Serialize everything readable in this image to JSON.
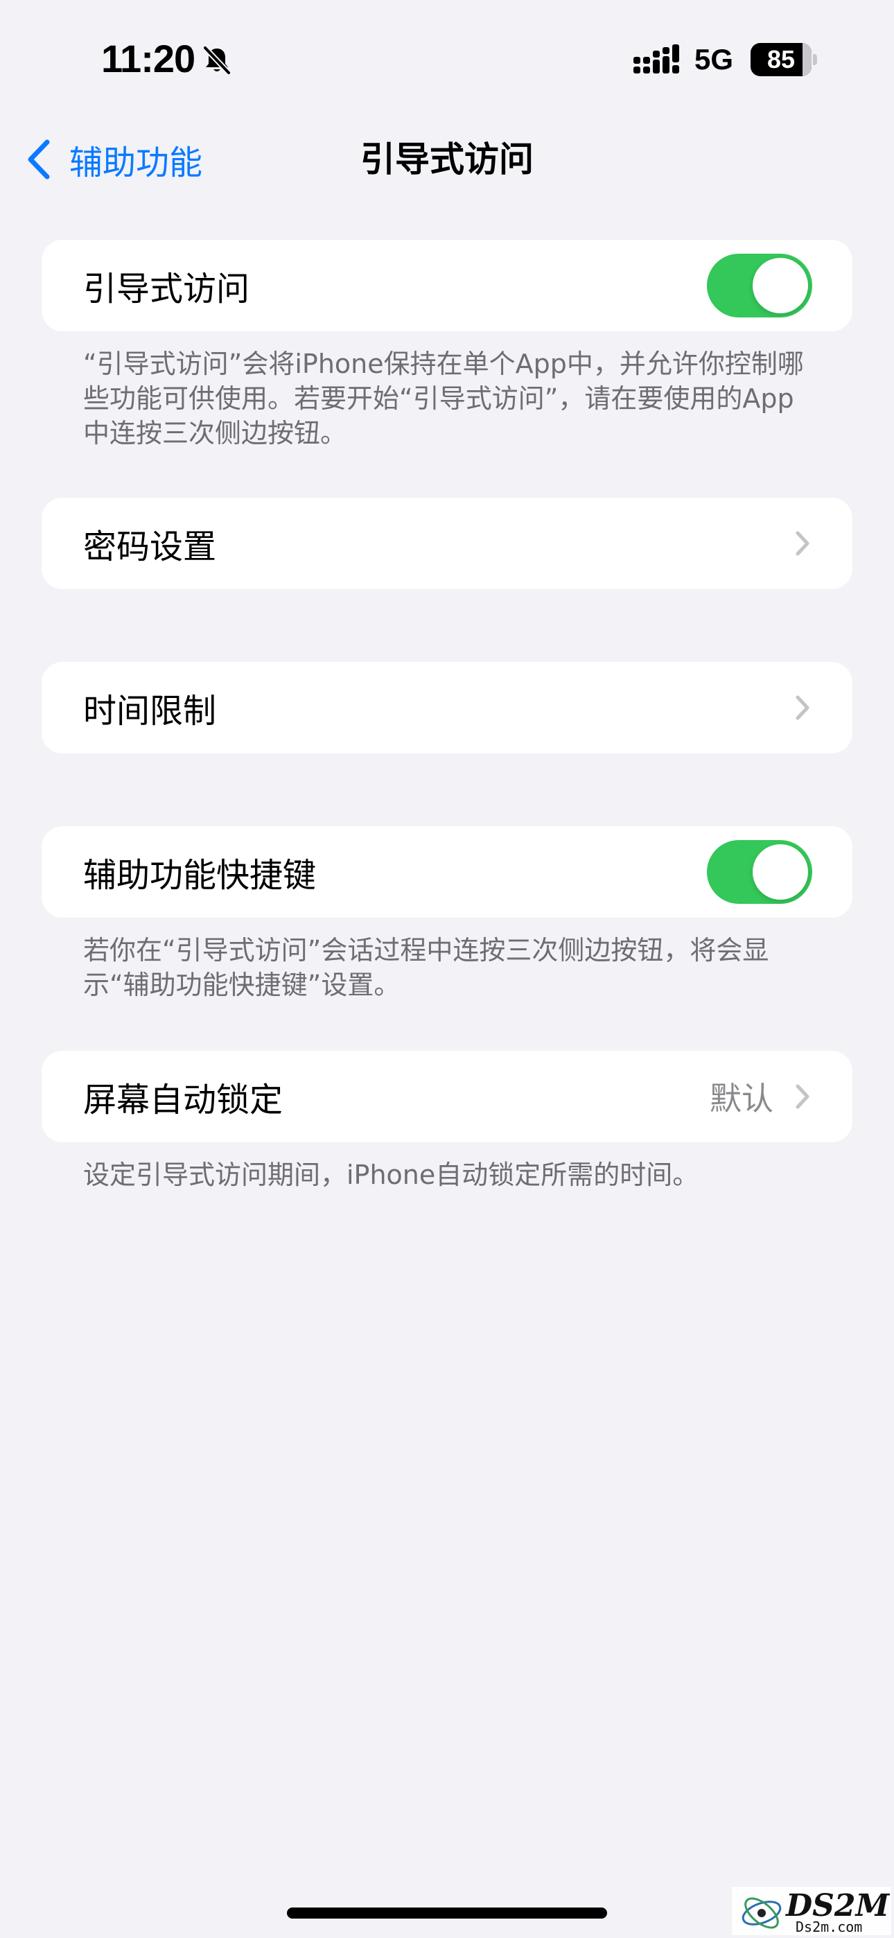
{
  "status_bar": {
    "time": "11:20",
    "network": "5G",
    "battery_level": "85",
    "icons": [
      "bell-slash-icon",
      "signal-icon",
      "battery-icon"
    ]
  },
  "nav": {
    "back_label": "辅助功能",
    "title": "引导式访问"
  },
  "accent_color": "#0A7AFF",
  "toggle_on_color": "#34C759",
  "groups": {
    "guided_access": {
      "label": "引导式访问",
      "toggle": "on",
      "footer": "“引导式访问”会将iPhone保持在单个App中，并允许你控制哪些功能可供使用。若要开始“引导式访问”，请在要使用的App中连按三次侧边按钮。"
    },
    "passcode": {
      "label": "密码设置"
    },
    "time_limits": {
      "label": "时间限制"
    },
    "accessibility_shortcut": {
      "label": "辅助功能快捷键",
      "toggle": "on",
      "footer": "若你在“引导式访问”会话过程中连按三次侧边按钮，将会显示“辅助功能快捷键”设置。"
    },
    "auto_lock": {
      "label": "屏幕自动锁定",
      "value": "默认",
      "footer": "设定引导式访问期间，iPhone自动锁定所需的时间。"
    }
  },
  "watermark": {
    "main": "DS2M",
    "sub": "Ds2m.com"
  }
}
